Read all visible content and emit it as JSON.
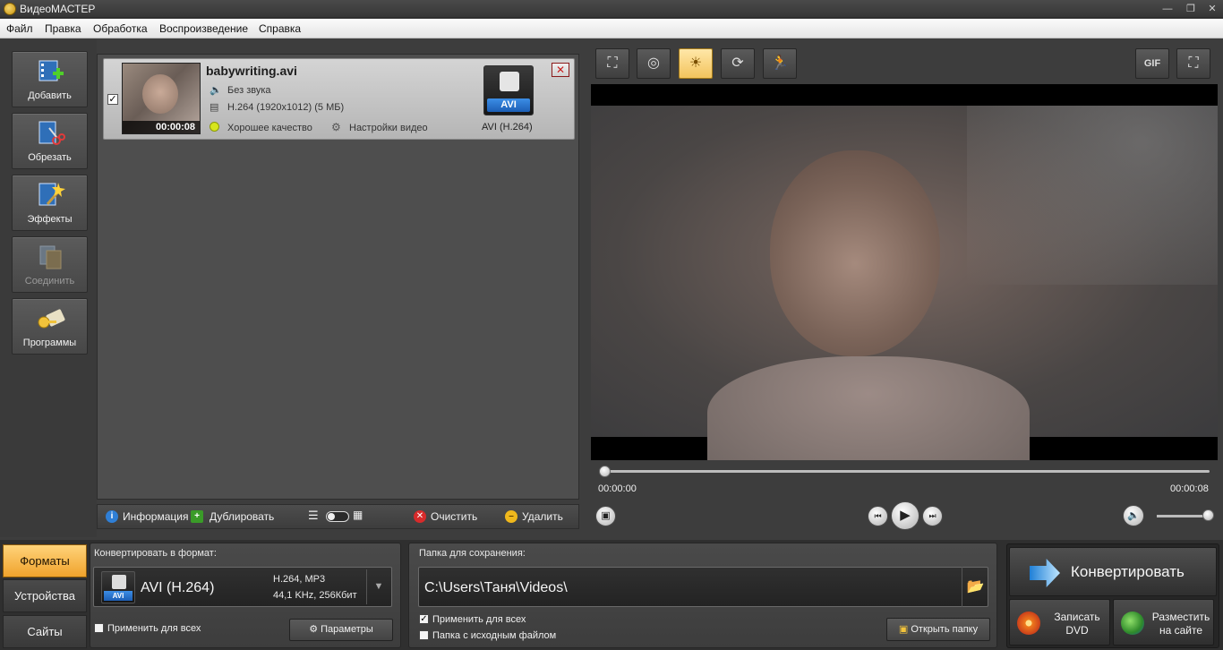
{
  "window": {
    "title": "ВидеоМАСТЕР",
    "minimize": "—",
    "restore": "❐",
    "close": "✕"
  },
  "menu": [
    "Файл",
    "Правка",
    "Обработка",
    "Воспроизведение",
    "Справка"
  ],
  "left_tools": [
    {
      "label": "Добавить",
      "icon": "add-video-icon",
      "enabled": true
    },
    {
      "label": "Обрезать",
      "icon": "trim-scissors-icon",
      "enabled": true
    },
    {
      "label": "Эффекты",
      "icon": "effects-wand-icon",
      "enabled": true
    },
    {
      "label": "Соединить",
      "icon": "join-film-icon",
      "enabled": false
    },
    {
      "label": "Программы",
      "icon": "programs-keys-icon",
      "enabled": true
    }
  ],
  "file": {
    "checked": true,
    "name": "babywriting.avi",
    "duration": "00:00:08",
    "audio": "Без звука",
    "video": "H.264 (1920x1012) (5 МБ)",
    "quality": "Хорошее качество",
    "video_settings": "Настройки видео",
    "format_badge": "AVI",
    "format_label": "AVI (H.264)",
    "remove": "✕"
  },
  "file_actions": {
    "info": "Информация",
    "duplicate": "Дублировать",
    "clear": "Очистить",
    "delete": "Удалить"
  },
  "preview": {
    "tools": [
      "crop-icon",
      "stabilize-icon",
      "brightness-icon",
      "rotate-icon",
      "speed-runner-icon"
    ],
    "gif": "GIF",
    "time_current": "00:00:00",
    "time_total": "00:00:08",
    "progress": 0,
    "volume": 1.0
  },
  "bottom": {
    "tabs": [
      "Форматы",
      "Устройства",
      "Сайты"
    ],
    "active_tab": "Форматы",
    "format_title": "Конвертировать в формат:",
    "format_badge": "AVI",
    "format_name": "AVI (H.264)",
    "format_codec": "H.264, MP3",
    "format_audio": "44,1 KHz, 256Кбит",
    "apply_all": "Применить для всех",
    "apply_all_checked": false,
    "params": "Параметры",
    "folder_title": "Папка для сохранения:",
    "folder_path": "C:\\Users\\Таня\\Videos\\",
    "folder_apply_all": "Применить для всех",
    "folder_apply_all_checked": true,
    "source_folder": "Папка с исходным файлом",
    "source_folder_checked": false,
    "open_folder": "Открыть папку",
    "convert": "Конвертировать",
    "burn_dvd_1": "Записать",
    "burn_dvd_2": "DVD",
    "publish_1": "Разместить",
    "publish_2": "на сайте"
  }
}
